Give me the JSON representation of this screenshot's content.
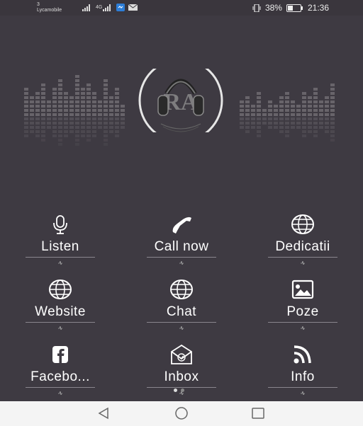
{
  "status_bar": {
    "carrier_top": "3",
    "carrier": "Lycamobile",
    "network_type": "4G",
    "battery_percent": "38%",
    "time": "21:36"
  },
  "menu": [
    {
      "label": "Listen",
      "icon": "microphone-icon"
    },
    {
      "label": "Call now",
      "icon": "phone-icon"
    },
    {
      "label": "Dedicatii",
      "icon": "globe-icon"
    },
    {
      "label": "Website",
      "icon": "globe-icon"
    },
    {
      "label": "Chat",
      "icon": "globe-icon"
    },
    {
      "label": "Poze",
      "icon": "image-icon"
    },
    {
      "label": "Facebo...",
      "icon": "facebook-icon"
    },
    {
      "label": "Inbox",
      "icon": "mail-icon"
    },
    {
      "label": "Info",
      "icon": "rss-icon"
    }
  ],
  "pager": {
    "pages": 2,
    "current": 1
  },
  "colors": {
    "background": "#3e3a42",
    "navbar": "#f4f4f4"
  }
}
